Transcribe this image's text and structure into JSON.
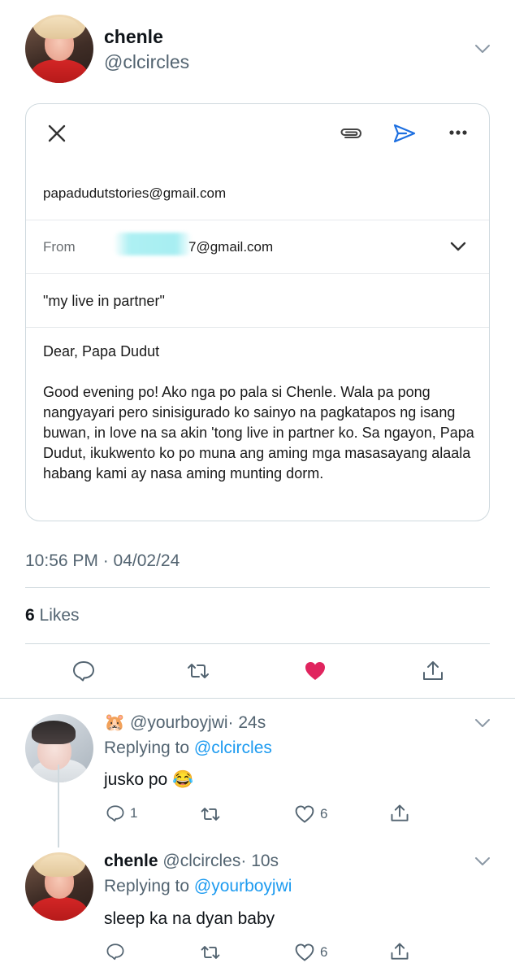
{
  "tweet": {
    "author_name": "chenle",
    "author_handle": "@clcircles",
    "timestamp": "10:56 PM · 04/02/24",
    "likes_count": "6",
    "likes_label": "Likes"
  },
  "email": {
    "to": "papadudutstories@gmail.com",
    "from_label": "From",
    "from_value": "7@gmail.com",
    "subject": "\"my live in partner\"",
    "salutation": "Dear, Papa Dudut",
    "body": "Good evening po! Ako nga po pala si Chenle. Wala pa pong nangyayari pero sinisigurado ko sainyo na pagkatapos ng isang buwan, in love na sa akin 'tong live in partner ko. Sa ngayon, Papa Dudut, ikukwento ko po muna ang aming mga masasayang alaala habang kami ay nasa aming munting dorm."
  },
  "icons": {
    "close": "close-icon",
    "attach": "paperclip-icon",
    "send": "send-icon",
    "more": "more-icon",
    "reply": "reply-icon",
    "retweet": "retweet-icon",
    "like": "heart-icon",
    "share": "share-icon"
  },
  "colors": {
    "accent": "#1d9bf0",
    "liked": "#e0245e",
    "muted": "#536471"
  },
  "replies": [
    {
      "emoji": "🐹",
      "handle": "@yourboyjwi",
      "time": "· 24s",
      "replying_label": "Replying to",
      "replying_to": "@clcircles",
      "text": "jusko po 😂",
      "reply_count": "1",
      "like_count": "6"
    },
    {
      "name": "chenle",
      "handle": "@clcircles",
      "time": "· 10s",
      "replying_label": "Replying to",
      "replying_to": "@yourboyjwi",
      "text": "sleep ka na dyan baby",
      "like_count": "6"
    }
  ]
}
